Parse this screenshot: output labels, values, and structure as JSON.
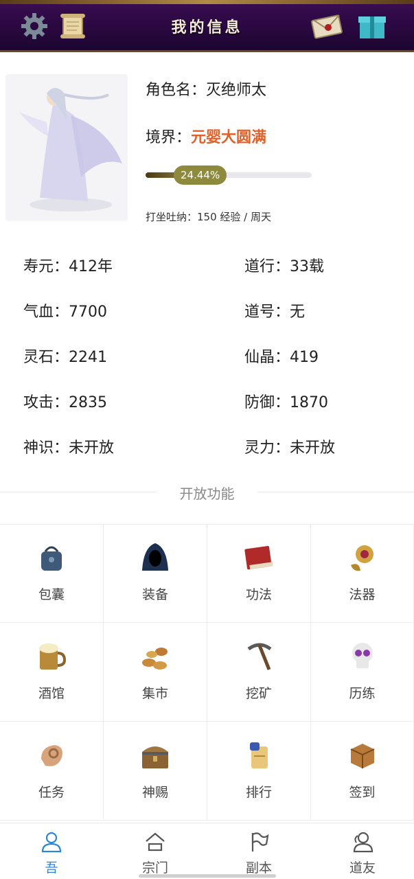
{
  "header": {
    "title": "我的信息",
    "icons": [
      "gear-icon",
      "scroll-icon",
      "mail-icon",
      "gift-box-icon"
    ]
  },
  "profile": {
    "name_label": "角色名：",
    "name_value": "灭绝师太",
    "realm_label": "境界：",
    "realm_value": "元婴大圆满",
    "progress_text": "24.44%",
    "progress_value": 0.2444,
    "meditate_text": "打坐吐纳：150 经验 / 周天",
    "realm_color": "#e0602a"
  },
  "stats": {
    "lifespan": "寿元：412年",
    "dao_years": "道行：33载",
    "hp": "气血：7700",
    "dao_title": "道号：无",
    "spirit_stones": "灵石：2241",
    "immortal_crystal": "仙晶：419",
    "attack": "攻击：2835",
    "defense": "防御：1870",
    "divine_sense": "神识：未开放",
    "spirit_power": "灵力：未开放"
  },
  "features": {
    "section_title": "开放功能",
    "items": [
      {
        "label": "包囊",
        "icon": "bag-icon"
      },
      {
        "label": "装备",
        "icon": "hooded-cloak-icon"
      },
      {
        "label": "功法",
        "icon": "book-icon"
      },
      {
        "label": "法器",
        "icon": "magic-artifact-icon"
      },
      {
        "label": "酒馆",
        "icon": "beer-mug-icon"
      },
      {
        "label": "集市",
        "icon": "coins-icon"
      },
      {
        "label": "挖矿",
        "icon": "pickaxe-icon"
      },
      {
        "label": "历练",
        "icon": "skull-icon"
      },
      {
        "label": "任务",
        "icon": "scroll-roll-icon"
      },
      {
        "label": "神赐",
        "icon": "treasure-chest-icon"
      },
      {
        "label": "排行",
        "icon": "ranking-scroll-icon"
      },
      {
        "label": "签到",
        "icon": "crate-icon"
      }
    ]
  },
  "tabs": [
    {
      "label": "吾",
      "icon": "user-icon",
      "active": true
    },
    {
      "label": "宗门",
      "icon": "house-icon",
      "active": false
    },
    {
      "label": "副本",
      "icon": "flag-icon",
      "active": false
    },
    {
      "label": "道友",
      "icon": "friends-icon",
      "active": false
    }
  ],
  "colors": {
    "accent": "#2b86d6",
    "header_bg": "#2a0840",
    "progress_pill": "#8d8a3e"
  }
}
